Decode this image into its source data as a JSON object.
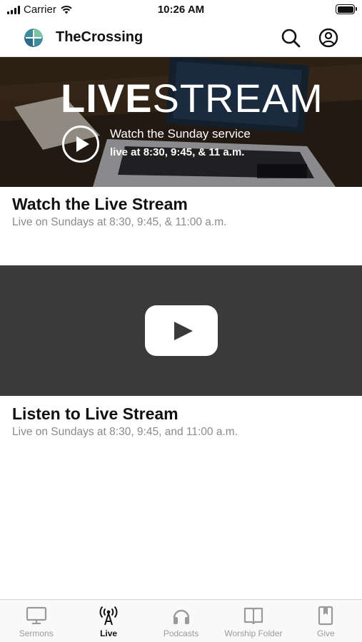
{
  "status_bar": {
    "carrier": "Carrier",
    "time": "10:26 AM"
  },
  "header": {
    "app_title": "TheCrossing",
    "search_icon": "search-icon",
    "account_icon": "account-icon"
  },
  "hero": {
    "title_bold": "LIVE",
    "title_light": "STREAM",
    "line1": "Watch the Sunday service",
    "line2": "live at 8:30, 9:45, & 11 a.m."
  },
  "items": [
    {
      "title": "Watch the Live Stream",
      "subtitle": "Live on Sundays at 8:30, 9:45, & 11:00 a.m."
    },
    {
      "title": "Listen to Live Stream",
      "subtitle": "Live on Sundays at 8:30, 9:45, and 11:00 a.m."
    }
  ],
  "tabs": [
    {
      "label": "Sermons",
      "icon": "tv-icon",
      "active": false
    },
    {
      "label": "Live",
      "icon": "broadcast-icon",
      "active": true
    },
    {
      "label": "Podcasts",
      "icon": "headphones-icon",
      "active": false
    },
    {
      "label": "Worship Folder",
      "icon": "book-icon",
      "active": false
    },
    {
      "label": "Give",
      "icon": "bookmark-icon",
      "active": false
    }
  ],
  "colors": {
    "accent_dark": "#111111",
    "inactive_tab": "#9a9a9a",
    "video_bg": "#3a3a3a"
  }
}
